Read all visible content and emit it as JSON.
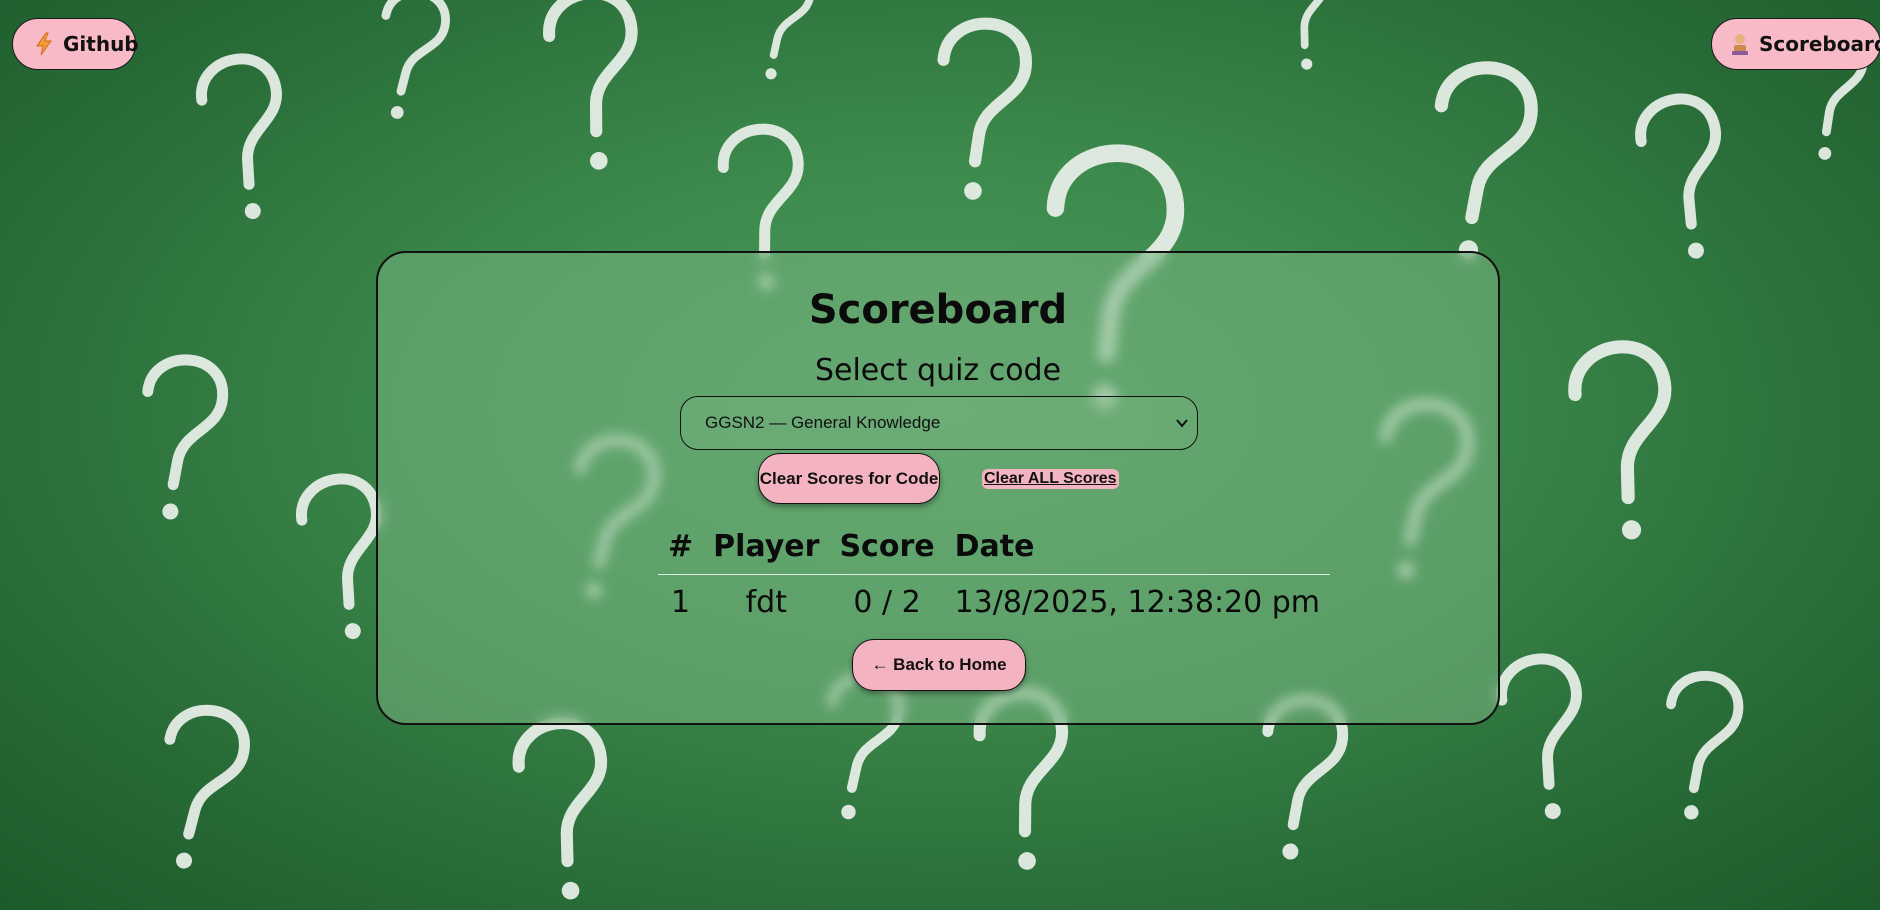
{
  "nav": {
    "github_label": "Github",
    "github_icon": "lightning-icon",
    "scoreboard_label": "Scoreboard",
    "scoreboard_icon": "trophy-icon"
  },
  "scoreboard": {
    "title": "Scoreboard",
    "select_label": "Select quiz code",
    "selected_code": "GGSN2 — General Knowledge",
    "clear_code_label": "Clear Scores for Code",
    "clear_all_label": "Clear ALL Scores",
    "columns": [
      "#",
      "Player",
      "Score",
      "Date"
    ],
    "rows": [
      [
        "1",
        "fdt",
        "0 / 2",
        "13/8/2025, 12:38:20 pm"
      ]
    ],
    "back_label": "← Back to Home"
  },
  "colors": {
    "button_pink": "#f4b3c0",
    "background_green": "#3d8a4d",
    "card_green": "#78b482"
  }
}
